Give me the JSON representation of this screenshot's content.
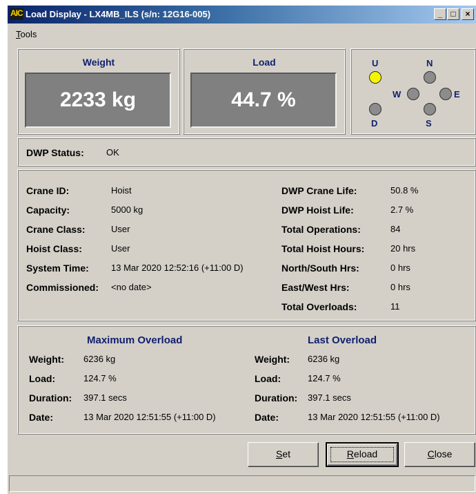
{
  "window": {
    "title": "Load Display - LX4MB_ILS (s/n: 12G16-005)",
    "icon_text": "AIC",
    "controls": {
      "minimize": "_",
      "maximize": "□",
      "close": "×"
    }
  },
  "menu": {
    "tools_first": "T",
    "tools_rest": "ools"
  },
  "gauges": {
    "weight": {
      "title": "Weight",
      "value": "2233 kg"
    },
    "load": {
      "title": "Load",
      "value": "44.7 %"
    }
  },
  "direction": {
    "labels": {
      "u": "U",
      "d": "D",
      "n": "N",
      "s": "S",
      "e": "E",
      "w": "W"
    },
    "active": [
      "U"
    ]
  },
  "dwp_status": {
    "label": "DWP Status:",
    "value": "OK"
  },
  "info_left": [
    {
      "label": "Crane ID:",
      "value": "Hoist"
    },
    {
      "label": "Capacity:",
      "value": "5000 kg"
    },
    {
      "label": "Crane Class:",
      "value": "User"
    },
    {
      "label": "Hoist Class:",
      "value": "User"
    },
    {
      "label": "System Time:",
      "value": "13 Mar 2020 12:52:16 (+11:00 D)"
    },
    {
      "label": "Commissioned:",
      "value": "<no date>"
    }
  ],
  "info_right": [
    {
      "label": "DWP Crane Life:",
      "value": "50.8 %"
    },
    {
      "label": "DWP Hoist Life:",
      "value": "2.7 %"
    },
    {
      "label": "Total Operations:",
      "value": "84"
    },
    {
      "label": "Total Hoist Hours:",
      "value": "20 hrs"
    },
    {
      "label": "North/South Hrs:",
      "value": "0 hrs"
    },
    {
      "label": "East/West Hrs:",
      "value": "0 hrs"
    },
    {
      "label": "Total Overloads:",
      "value": "11"
    }
  ],
  "max_overload": {
    "title": "Maximum Overload",
    "rows": [
      {
        "label": "Weight:",
        "value": "6236 kg"
      },
      {
        "label": "Load:",
        "value": "124.7 %"
      },
      {
        "label": "Duration:",
        "value": "397.1 secs"
      },
      {
        "label": "Date:",
        "value": "13 Mar 2020 12:51:55 (+11:00 D)"
      }
    ]
  },
  "last_overload": {
    "title": "Last Overload",
    "rows": [
      {
        "label": "Weight:",
        "value": "6236 kg"
      },
      {
        "label": "Load:",
        "value": "124.7 %"
      },
      {
        "label": "Duration:",
        "value": "397.1 secs"
      },
      {
        "label": "Date:",
        "value": "13 Mar 2020 12:51:55 (+11:00 D)"
      }
    ]
  },
  "buttons": {
    "set": {
      "first": "S",
      "rest": "et"
    },
    "reload": {
      "first": "R",
      "rest": "eload"
    },
    "close": {
      "first": "C",
      "rest": "lose"
    }
  },
  "colors": {
    "title_blue": "#0f1f6e",
    "indicator_on": "#f5f500",
    "indicator_off": "#8c8c8c",
    "gauge_bg": "#808080"
  }
}
